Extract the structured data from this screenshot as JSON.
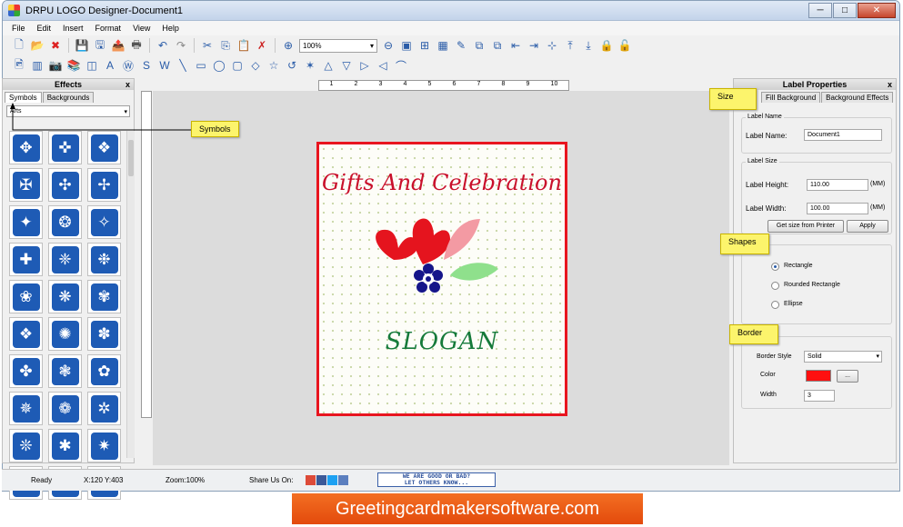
{
  "window": {
    "title": "DRPU LOGO Designer-Document1",
    "controls": [
      "─",
      "□",
      "✕"
    ]
  },
  "menu": [
    "File",
    "Edit",
    "Insert",
    "Format",
    "View",
    "Help"
  ],
  "toolbar": {
    "zoom_value": "100%"
  },
  "effects_panel": {
    "title": "Effects",
    "close_glyph": "x",
    "tabs": [
      "Symbols",
      "Backgrounds"
    ],
    "category": "Arts",
    "symbol_icons": [
      "✥",
      "✜",
      "❖",
      "✠",
      "✣",
      "✢",
      "✦",
      "❂",
      "✧",
      "✚",
      "❈",
      "❉",
      "❀",
      "❋",
      "✾",
      "❖",
      "✺",
      "✽",
      "✤",
      "❃",
      "✿",
      "✵",
      "❁",
      "✲",
      "❊",
      "✱",
      "✷",
      "❇",
      "✹",
      "❆"
    ]
  },
  "document": {
    "title_text": "Gifts And Celebration",
    "slogan_text": "SLOGAN",
    "border_color": "#e8151f"
  },
  "ruler": {
    "ticks": [
      "1",
      "2",
      "3",
      "4",
      "5",
      "6",
      "7",
      "8",
      "9",
      "10"
    ]
  },
  "properties_panel": {
    "title": "Label Properties",
    "close_glyph": "x",
    "tabs": [
      "Fill Background",
      "Background Effects"
    ],
    "label_name_group": "Label Name",
    "label_name_caption": "Label Name:",
    "label_name_value": "Document1",
    "label_size_group": "Label Size",
    "height_caption": "Label Height:",
    "height_value": "110.00",
    "height_unit": "(MM)",
    "width_caption": "Label Width:",
    "width_value": "100.00",
    "width_unit": "(MM)",
    "size_from_printer_btn": "Get size from Printer",
    "apply_btn": "Apply",
    "shapes": [
      "Rectangle",
      "Rounded Rectangle",
      "Ellipse"
    ],
    "selected_shape": "Rectangle",
    "border_style_caption": "Border Style",
    "border_style_value": "Solid",
    "color_caption": "Color",
    "color_value": "#ff1010",
    "color_btn": "...",
    "width_border_caption": "Width",
    "width_border_value": "3"
  },
  "callouts": {
    "symbols": "Symbols",
    "size": "Size",
    "shapes": "Shapes",
    "border": "Border"
  },
  "statusbar": {
    "ready": "Ready",
    "coords": "X:120  Y:403",
    "zoom": "Zoom:100%",
    "share": "Share Us On:",
    "good_bad_line1": "WE ARE GOOD OR BAD?",
    "good_bad_line2": "LET OTHERS KNOW..."
  },
  "banner": {
    "text": "Greetingcardmakersoftware.com"
  }
}
